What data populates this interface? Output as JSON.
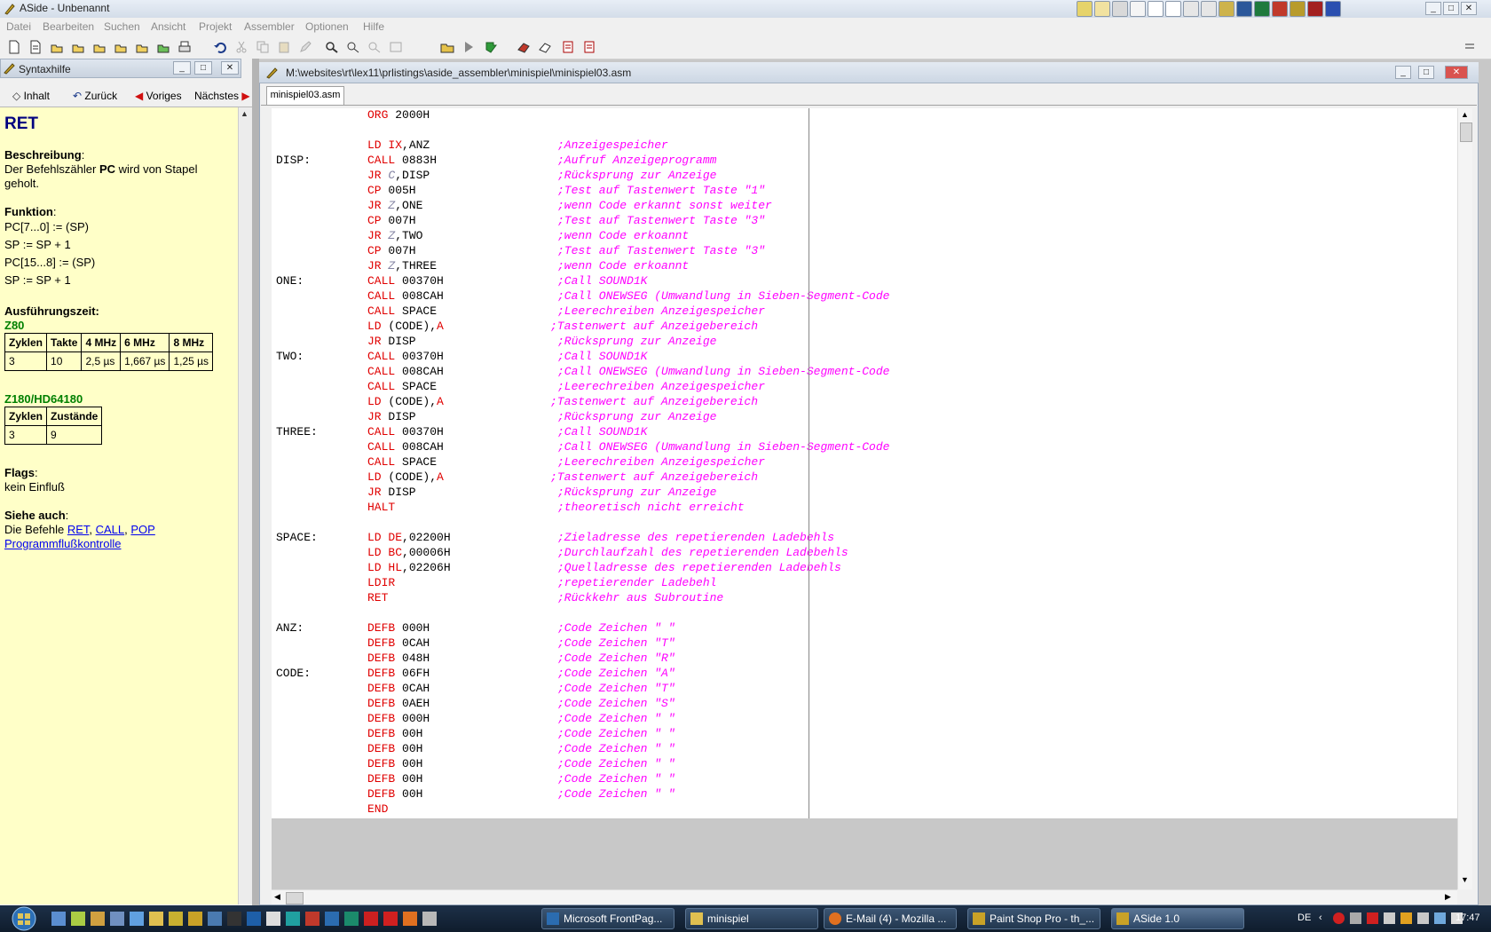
{
  "window": {
    "title": "ASide - Unbenannt"
  },
  "menu": [
    "Datei",
    "Bearbeiten",
    "Suchen",
    "Ansicht",
    "Projekt",
    "Assembler",
    "Optionen",
    "Hilfe"
  ],
  "syntax_panel": {
    "title": "Syntaxhilfe",
    "nav": {
      "inhalt": "Inhalt",
      "zurueck": "Zurück",
      "voriges": "Voriges",
      "naechstes": "Nächstes"
    },
    "heading": "RET",
    "beschreibung_label": "Beschreibung",
    "beschreibung_pre": "Der Befehlszähler ",
    "beschreibung_bold": "PC",
    "beschreibung_post": " wird von Stapel geholt.",
    "funktion_label": "Funktion",
    "funktion_lines": [
      "PC[7...0] := (SP)",
      "SP := SP + 1",
      "PC[15...8] := (SP)",
      "SP := SP + 1"
    ],
    "ausfuehrung_label": "Ausführungszeit:",
    "z80_label": "Z80",
    "z80_headers": [
      "Zyklen",
      "Takte",
      "4 MHz",
      "6 MHz",
      "8 MHz"
    ],
    "z80_values": [
      "3",
      "10",
      "2,5 µs",
      "1,667 µs",
      "1,25 µs"
    ],
    "z180_label": "Z180/HD64180",
    "z180_headers": [
      "Zyklen",
      "Zustände"
    ],
    "z180_values": [
      "3",
      "9"
    ],
    "flags_label": "Flags",
    "flags_text": "kein Einfluß",
    "siehe_label": "Siehe auch",
    "siehe_pre": "Die Befehle ",
    "links": [
      "RET",
      "CALL",
      "POP"
    ],
    "link_bottom": "Programmflußkontrolle"
  },
  "editor": {
    "path": "M:\\websites\\rt\\lex11\\prlistings\\aside_assembler\\minispiel\\minispiel03.asm",
    "tab": "minispiel03.asm",
    "lines": [
      {
        "label": "",
        "mn": "ORG",
        "ops": [
          {
            "t": "2000H",
            "c": "op"
          }
        ],
        "comment": ""
      },
      {
        "label": "",
        "mn": "",
        "ops": [],
        "comment": ""
      },
      {
        "label": "",
        "mn": "LD",
        "ops": [
          {
            "t": "IX",
            "c": "reg"
          },
          {
            "t": ",ANZ",
            "c": "op"
          }
        ],
        "comment": ";Anzeigespeicher"
      },
      {
        "label": "DISP:",
        "mn": "CALL",
        "ops": [
          {
            "t": "0883H",
            "c": "op"
          }
        ],
        "comment": ";Aufruf Anzeigeprogramm"
      },
      {
        "label": "",
        "mn": "JR",
        "ops": [
          {
            "t": "C",
            "c": "cond"
          },
          {
            "t": ",DISP",
            "c": "op"
          }
        ],
        "comment": ";Rücksprung zur Anzeige"
      },
      {
        "label": "",
        "mn": "CP",
        "ops": [
          {
            "t": "005H",
            "c": "op"
          }
        ],
        "comment": ";Test auf Tastenwert Taste \"1\""
      },
      {
        "label": "",
        "mn": "JR",
        "ops": [
          {
            "t": "Z",
            "c": "cond"
          },
          {
            "t": ",ONE",
            "c": "op"
          }
        ],
        "comment": ";wenn Code erkannt sonst weiter"
      },
      {
        "label": "",
        "mn": "CP",
        "ops": [
          {
            "t": "007H",
            "c": "op"
          }
        ],
        "comment": ";Test auf Tastenwert Taste \"3\""
      },
      {
        "label": "",
        "mn": "JR",
        "ops": [
          {
            "t": "Z",
            "c": "cond"
          },
          {
            "t": ",TWO",
            "c": "op"
          }
        ],
        "comment": ";wenn Code erkoannt"
      },
      {
        "label": "",
        "mn": "CP",
        "ops": [
          {
            "t": "007H",
            "c": "op"
          }
        ],
        "comment": ";Test auf Tastenwert Taste \"3\""
      },
      {
        "label": "",
        "mn": "JR",
        "ops": [
          {
            "t": "Z",
            "c": "cond"
          },
          {
            "t": ",THREE",
            "c": "op"
          }
        ],
        "comment": ";wenn Code erkoannt"
      },
      {
        "label": "ONE:",
        "mn": "CALL",
        "ops": [
          {
            "t": "00370H",
            "c": "op"
          }
        ],
        "comment": ";Call SOUND1K"
      },
      {
        "label": "",
        "mn": "CALL",
        "ops": [
          {
            "t": "008CAH",
            "c": "op"
          }
        ],
        "comment": ";Call ONEWSEG (Umwandlung in Sieben-Segment-Code"
      },
      {
        "label": "",
        "mn": "CALL",
        "ops": [
          {
            "t": "SPACE",
            "c": "op"
          }
        ],
        "comment": ";Leerechreiben Anzeigespeicher"
      },
      {
        "label": "",
        "mn": "LD",
        "ops": [
          {
            "t": "(CODE),",
            "c": "op"
          },
          {
            "t": "A",
            "c": "reg"
          }
        ],
        "comment": ";Tastenwert auf Anzeigebereich",
        "cshift": true
      },
      {
        "label": "",
        "mn": "JR",
        "ops": [
          {
            "t": "DISP",
            "c": "op"
          }
        ],
        "comment": ";Rücksprung zur Anzeige"
      },
      {
        "label": "TWO:",
        "mn": "CALL",
        "ops": [
          {
            "t": "00370H",
            "c": "op"
          }
        ],
        "comment": ";Call SOUND1K"
      },
      {
        "label": "",
        "mn": "CALL",
        "ops": [
          {
            "t": "008CAH",
            "c": "op"
          }
        ],
        "comment": ";Call ONEWSEG (Umwandlung in Sieben-Segment-Code"
      },
      {
        "label": "",
        "mn": "CALL",
        "ops": [
          {
            "t": "SPACE",
            "c": "op"
          }
        ],
        "comment": ";Leerechreiben Anzeigespeicher"
      },
      {
        "label": "",
        "mn": "LD",
        "ops": [
          {
            "t": "(CODE),",
            "c": "op"
          },
          {
            "t": "A",
            "c": "reg"
          }
        ],
        "comment": ";Tastenwert auf Anzeigebereich",
        "cshift": true
      },
      {
        "label": "",
        "mn": "JR",
        "ops": [
          {
            "t": "DISP",
            "c": "op"
          }
        ],
        "comment": ";Rücksprung zur Anzeige"
      },
      {
        "label": "THREE:",
        "mn": "CALL",
        "ops": [
          {
            "t": "00370H",
            "c": "op"
          }
        ],
        "comment": ";Call SOUND1K"
      },
      {
        "label": "",
        "mn": "CALL",
        "ops": [
          {
            "t": "008CAH",
            "c": "op"
          }
        ],
        "comment": ";Call ONEWSEG (Umwandlung in Sieben-Segment-Code"
      },
      {
        "label": "",
        "mn": "CALL",
        "ops": [
          {
            "t": "SPACE",
            "c": "op"
          }
        ],
        "comment": ";Leerechreiben Anzeigespeicher"
      },
      {
        "label": "",
        "mn": "LD",
        "ops": [
          {
            "t": "(CODE),",
            "c": "op"
          },
          {
            "t": "A",
            "c": "reg"
          }
        ],
        "comment": ";Tastenwert auf Anzeigebereich",
        "cshift": true
      },
      {
        "label": "",
        "mn": "JR",
        "ops": [
          {
            "t": "DISP",
            "c": "op"
          }
        ],
        "comment": ";Rücksprung zur Anzeige"
      },
      {
        "label": "",
        "mn": "HALT",
        "ops": [],
        "comment": ";theoretisch nicht erreicht"
      },
      {
        "label": "",
        "mn": "",
        "ops": [],
        "comment": ""
      },
      {
        "label": "SPACE:",
        "mn": "LD",
        "ops": [
          {
            "t": "DE",
            "c": "reg"
          },
          {
            "t": ",02200H",
            "c": "op"
          }
        ],
        "comment": ";Zieladresse des repetierenden Ladebehls"
      },
      {
        "label": "",
        "mn": "LD",
        "ops": [
          {
            "t": "BC",
            "c": "reg"
          },
          {
            "t": ",00006H",
            "c": "op"
          }
        ],
        "comment": ";Durchlaufzahl des repetierenden Ladebehls"
      },
      {
        "label": "",
        "mn": "LD",
        "ops": [
          {
            "t": "HL",
            "c": "reg"
          },
          {
            "t": ",02206H",
            "c": "op"
          }
        ],
        "comment": ";Quelladresse des repetierenden Ladebehls"
      },
      {
        "label": "",
        "mn": "LDIR",
        "ops": [],
        "comment": ";repetierender Ladebehl"
      },
      {
        "label": "",
        "mn": "RET",
        "ops": [],
        "comment": ";Rückkehr aus Subroutine"
      },
      {
        "label": "",
        "mn": "",
        "ops": [],
        "comment": ""
      },
      {
        "label": "ANZ:",
        "mn": "DEFB",
        "ops": [
          {
            "t": "000H",
            "c": "op"
          }
        ],
        "comment": ";Code Zeichen \" \""
      },
      {
        "label": "",
        "mn": "DEFB",
        "ops": [
          {
            "t": "0CAH",
            "c": "op"
          }
        ],
        "comment": ";Code Zeichen \"T\""
      },
      {
        "label": "",
        "mn": "DEFB",
        "ops": [
          {
            "t": "048H",
            "c": "op"
          }
        ],
        "comment": ";Code Zeichen \"R\""
      },
      {
        "label": "CODE:",
        "mn": "DEFB",
        "ops": [
          {
            "t": "06FH",
            "c": "op"
          }
        ],
        "comment": ";Code Zeichen \"A\""
      },
      {
        "label": "",
        "mn": "DEFB",
        "ops": [
          {
            "t": "0CAH",
            "c": "op"
          }
        ],
        "comment": ";Code Zeichen \"T\""
      },
      {
        "label": "",
        "mn": "DEFB",
        "ops": [
          {
            "t": "0AEH",
            "c": "op"
          }
        ],
        "comment": ";Code Zeichen \"S\""
      },
      {
        "label": "",
        "mn": "DEFB",
        "ops": [
          {
            "t": "000H",
            "c": "op"
          }
        ],
        "comment": ";Code Zeichen \" \""
      },
      {
        "label": "",
        "mn": "DEFB",
        "ops": [
          {
            "t": "00H",
            "c": "op"
          }
        ],
        "comment": ";Code Zeichen \" \""
      },
      {
        "label": "",
        "mn": "DEFB",
        "ops": [
          {
            "t": "00H",
            "c": "op"
          }
        ],
        "comment": ";Code Zeichen \" \""
      },
      {
        "label": "",
        "mn": "DEFB",
        "ops": [
          {
            "t": "00H",
            "c": "op"
          }
        ],
        "comment": ";Code Zeichen \" \""
      },
      {
        "label": "",
        "mn": "DEFB",
        "ops": [
          {
            "t": "00H",
            "c": "op"
          }
        ],
        "comment": ";Code Zeichen \" \""
      },
      {
        "label": "",
        "mn": "DEFB",
        "ops": [
          {
            "t": "00H",
            "c": "op"
          }
        ],
        "comment": ";Code Zeichen \" \""
      },
      {
        "label": "",
        "mn": "END",
        "ops": [],
        "comment": ""
      }
    ]
  },
  "taskbar": {
    "tasks": [
      "Microsoft FrontPag...",
      "minispiel",
      "E-Mail (4) - Mozilla ...",
      "Paint Shop Pro - th_...",
      "ASide 1.0"
    ],
    "lang": "DE",
    "clock": "17:47"
  },
  "colors": {
    "help_bg": "#ffffc8",
    "mnemonic": "#e00000",
    "comment": "#ff00ff",
    "heading": "#000080",
    "green": "#008000",
    "link": "#0000ee"
  }
}
